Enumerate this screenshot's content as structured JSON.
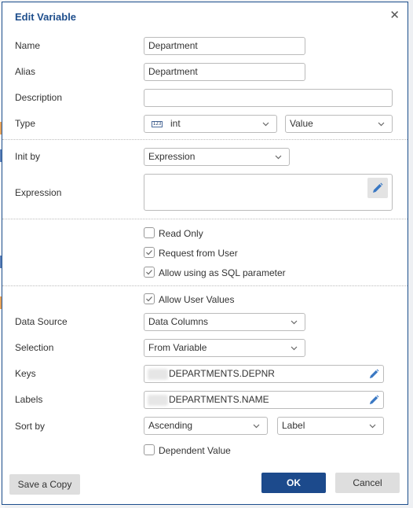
{
  "dialog": {
    "title": "Edit Variable",
    "close_icon": "close-icon"
  },
  "fields": {
    "name": {
      "label": "Name",
      "value": "Department"
    },
    "alias": {
      "label": "Alias",
      "value": "Department"
    },
    "description": {
      "label": "Description",
      "value": ""
    },
    "type": {
      "label": "Type",
      "value": "int",
      "icon": "number-type-icon",
      "icon_text": "123",
      "mode": "Value"
    },
    "init_by": {
      "label": "Init by",
      "value": "Expression"
    },
    "expression": {
      "label": "Expression",
      "value": "",
      "edit_icon": "pencil-icon"
    }
  },
  "options": {
    "read_only": {
      "label": "Read Only",
      "checked": false
    },
    "request_from_user": {
      "label": "Request from User",
      "checked": true
    },
    "allow_sql_param": {
      "label": "Allow using as SQL parameter",
      "checked": true
    },
    "allow_user_values": {
      "label": "Allow User Values",
      "checked": true
    }
  },
  "data": {
    "data_source": {
      "label": "Data Source",
      "value": "Data Columns"
    },
    "selection": {
      "label": "Selection",
      "value": "From Variable"
    },
    "keys": {
      "label": "Keys",
      "value": "DEPARTMENTS.DEPNR"
    },
    "labels": {
      "label": "Labels",
      "value": "DEPARTMENTS.NAME"
    },
    "sort_by": {
      "label": "Sort by",
      "order": "Ascending",
      "field": "Label"
    },
    "dependent_value": {
      "label": "Dependent Value",
      "checked": false
    }
  },
  "footer": {
    "save_copy": "Save a Copy",
    "ok": "OK",
    "cancel": "Cancel"
  },
  "colors": {
    "accent": "#1c4a8c",
    "title": "#1e4e8c",
    "pencil": "#3a78c3"
  }
}
